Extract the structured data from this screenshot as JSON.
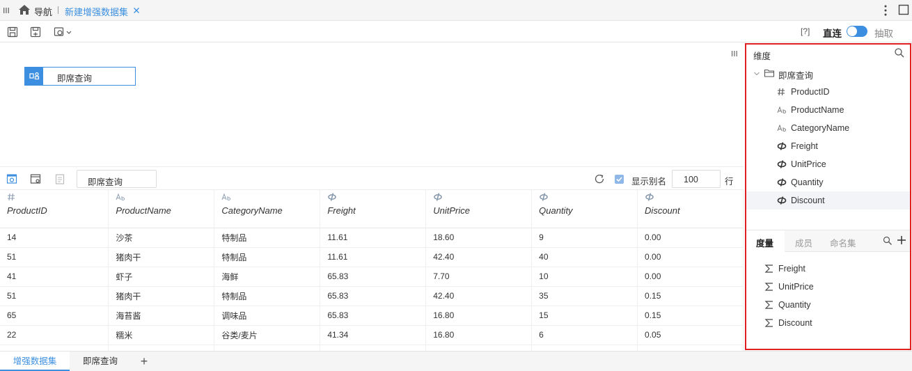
{
  "topbar": {
    "nav_label": "导航",
    "active_tab": "新建增强数据集"
  },
  "toolbar": {
    "help": "[?]",
    "mode_direct": "直连",
    "mode_extract": "抽取"
  },
  "canvas": {
    "node_label": "即席查询"
  },
  "gridbar": {
    "query_name": "即席查询",
    "show_alias": "显示别名",
    "rows_value": "100",
    "rows_unit": "行"
  },
  "grid": {
    "columns": [
      {
        "name": "ProductID",
        "type": "#"
      },
      {
        "name": "ProductName",
        "type": "Ab"
      },
      {
        "name": "CategoryName",
        "type": "Ab"
      },
      {
        "name": "Freight",
        "type": "measure"
      },
      {
        "name": "UnitPrice",
        "type": "measure"
      },
      {
        "name": "Quantity",
        "type": "measure"
      },
      {
        "name": "Discount",
        "type": "measure"
      }
    ],
    "rows": [
      [
        "14",
        "沙茶",
        "特制品",
        "11.61",
        "18.60",
        "9",
        "0.00"
      ],
      [
        "51",
        "猪肉干",
        "特制品",
        "11.61",
        "42.40",
        "40",
        "0.00"
      ],
      [
        "41",
        "虾子",
        "海鲜",
        "65.83",
        "7.70",
        "10",
        "0.00"
      ],
      [
        "51",
        "猪肉干",
        "特制品",
        "65.83",
        "42.40",
        "35",
        "0.15"
      ],
      [
        "65",
        "海苔酱",
        "调味品",
        "65.83",
        "16.80",
        "15",
        "0.15"
      ],
      [
        "22",
        "糯米",
        "谷类/麦片",
        "41.34",
        "16.80",
        "6",
        "0.05"
      ],
      [
        "",
        "",
        "",
        "",
        "",
        "",
        ""
      ]
    ]
  },
  "right": {
    "dim_title": "维度",
    "folder": "即席查询",
    "fields": [
      {
        "name": "ProductID",
        "type": "#"
      },
      {
        "name": "ProductName",
        "type": "Ab"
      },
      {
        "name": "CategoryName",
        "type": "Ab"
      },
      {
        "name": "Freight",
        "type": "measure"
      },
      {
        "name": "UnitPrice",
        "type": "measure"
      },
      {
        "name": "Quantity",
        "type": "measure"
      },
      {
        "name": "Discount",
        "type": "measure"
      }
    ],
    "tabs": [
      "度量",
      "成员",
      "命名集"
    ],
    "measures": [
      "Freight",
      "UnitPrice",
      "Quantity",
      "Discount"
    ]
  },
  "bottom": {
    "tabs": [
      "增强数据集",
      "即席查询"
    ],
    "add": "+"
  },
  "colors": {
    "accent": "#3c8fe0",
    "highlight_border": "#e02020"
  }
}
